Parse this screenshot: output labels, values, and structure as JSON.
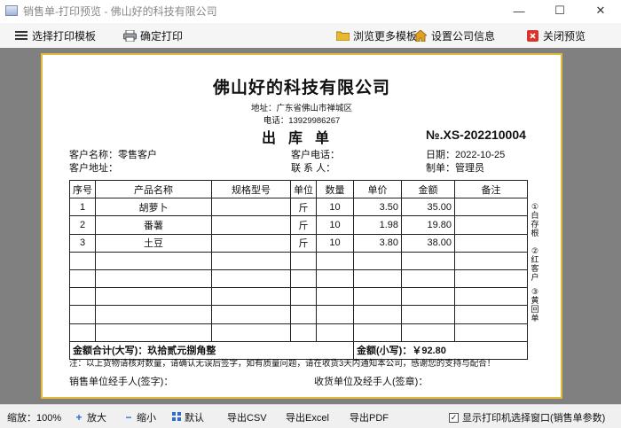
{
  "window": {
    "title": "销售单-打印预览 - 佛山好的科技有限公司",
    "minimize": "—",
    "maximize": "☐",
    "close": "✕"
  },
  "toolbar": {
    "select_template": "选择打印模板",
    "confirm_print": "确定打印",
    "browse_templates": "浏览更多模板",
    "company_settings": "设置公司信息",
    "close_preview": "关闭预览"
  },
  "doc": {
    "company": "佛山好的科技有限公司",
    "address": "地址：广东省佛山市禅城区",
    "phone": "电话：13929986267",
    "title": "出库单",
    "number": "№.XS-202210004",
    "customer_name_label": "客户名称：",
    "customer_name": "零售客户",
    "customer_addr_label": "客户地址：",
    "customer_phone_label": "客户电话：",
    "contact_label": "联 系 人：",
    "date_label": "日期：",
    "date": "2022-10-25",
    "maker_label": "制单：",
    "maker": "管理员"
  },
  "table": {
    "headers": [
      "序号",
      "产品名称",
      "规格型号",
      "单位",
      "数量",
      "单价",
      "金额",
      "备注"
    ],
    "rows": [
      [
        "1",
        "胡萝卜",
        "",
        "斤",
        "10",
        "3.50",
        "35.00",
        ""
      ],
      [
        "2",
        "番薯",
        "",
        "斤",
        "10",
        "1.98",
        "19.80",
        ""
      ],
      [
        "3",
        "土豆",
        "",
        "斤",
        "10",
        "3.80",
        "38.00",
        ""
      ]
    ],
    "total_upper": "金额合计(大写)：玖拾贰元捌角整",
    "total_lower": "金额(小写)：￥92.80"
  },
  "side_labels": [
    "①白存根",
    "②红客户",
    "③黄回单"
  ],
  "footer": {
    "note": "注：以上货物请核对数量，请确认无误后签字，如有质量问题，请在收货3天内通知本公司，感谢您的支持与配合！",
    "seller_sign": "销售单位经手人(签字)：",
    "receiver_sign": "收货单位及经手人(签章)："
  },
  "statusbar": {
    "zoom": "缩放：100%",
    "zoom_in": "放大",
    "zoom_out": "缩小",
    "default": "默认",
    "export_csv": "导出CSV",
    "export_excel": "导出Excel",
    "export_pdf": "导出PDF",
    "show_printer_dialog": "显示打印机选择窗口(销售单参数)"
  },
  "colors": {
    "paper_border": "#e2b93b",
    "stage": "#808080"
  }
}
